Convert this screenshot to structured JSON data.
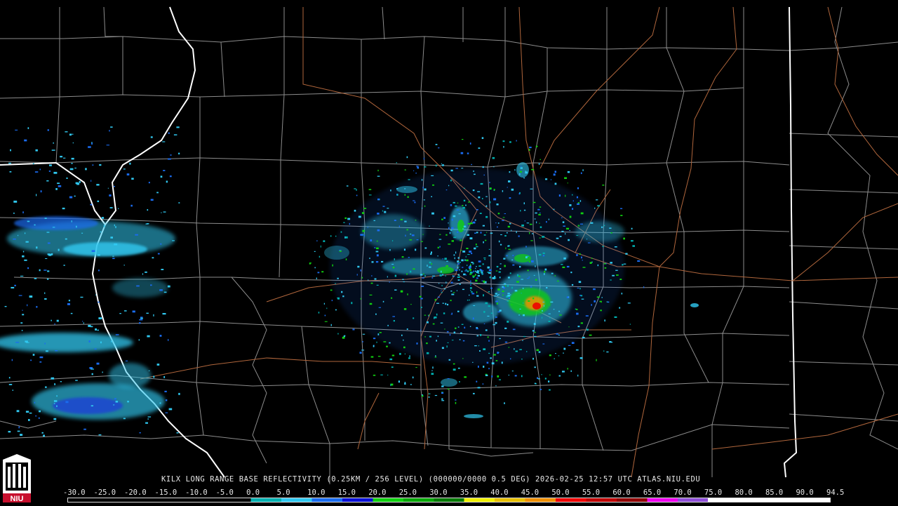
{
  "product_title": "KILX LONG RANGE BASE REFLECTIVITY (0.25KM / 256 LEVEL) (000000/0000 0.5 DEG) 2026-02-25 12:57 UTC  ATLAS.NIU.EDU",
  "logo_text": "NIU",
  "colors": {
    "background": "#000000",
    "county_lines": "#8c8c8c",
    "state_lines": "#ffffff",
    "highways": "#b0663c"
  },
  "color_scale": {
    "labels": [
      "-30.0",
      "-25.0",
      "-20.0",
      "-15.0",
      "-10.0",
      "-5.0",
      "0.0",
      "5.0",
      "10.0",
      "15.0",
      "20.0",
      "25.0",
      "30.0",
      "35.0",
      "40.0",
      "45.0",
      "50.0",
      "55.0",
      "60.0",
      "65.0",
      "70.0",
      "75.0",
      "80.0",
      "85.0",
      "90.0",
      "94.5"
    ],
    "segment_colors": [
      "#000000",
      "#000000",
      "#000000",
      "#000000",
      "#000000",
      "#000000",
      "#00b0b0",
      "#30c8f0",
      "#1a6cf0",
      "#0a10d8",
      "#10d010",
      "#08a808",
      "#067a06",
      "#f0f000",
      "#e8c000",
      "#f09000",
      "#f00000",
      "#c00000",
      "#900000",
      "#f000f0",
      "#9050d8",
      "#ffffff",
      "#ffffff",
      "#ffffff",
      "#ffffff"
    ]
  }
}
